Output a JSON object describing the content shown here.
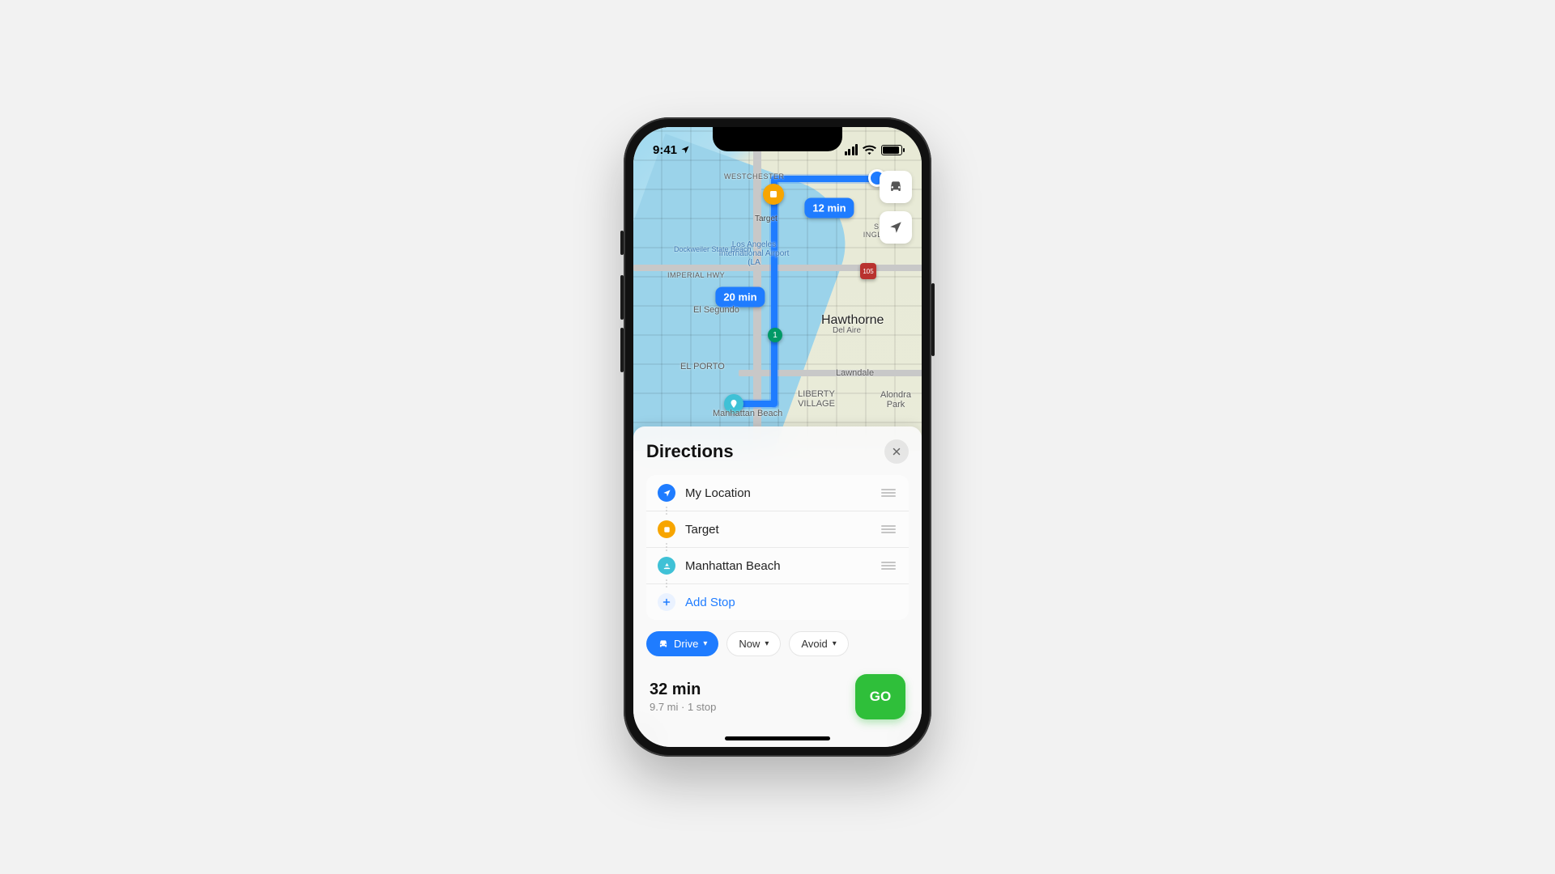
{
  "status": {
    "time": "9:41"
  },
  "map": {
    "eta_waypoint": "12 min",
    "eta_destination": "20 min",
    "shield_small": "1",
    "shield_hwy": "105",
    "labels": {
      "westchester": "WESTCHESTER",
      "target": "Target",
      "airport": "Los Angeles International Airport (LA",
      "dockweiler": "Dockweiler State Beach",
      "imperial": "IMPERIAL HWY",
      "elsegundo": "El Segundo",
      "hawthorne": "Hawthorne",
      "delaire": "Del Aire",
      "elporto": "EL PORTO",
      "lawndale": "Lawndale",
      "liberty": "LIBERTY VILLAGE",
      "alondra": "Alondra Park",
      "manhattan": "Manhattan Beach",
      "south_inglewood": "SOUTH INGLEWOOD"
    }
  },
  "sheet": {
    "title": "Directions",
    "stops": {
      "my_location": "My Location",
      "waypoint": "Target",
      "destination": "Manhattan Beach",
      "add_stop": "Add Stop"
    },
    "chips": {
      "mode": "Drive",
      "time": "Now",
      "avoid": "Avoid"
    },
    "summary": {
      "time": "32 min",
      "meta": "9.7 mi · 1 stop"
    },
    "go": "GO"
  }
}
